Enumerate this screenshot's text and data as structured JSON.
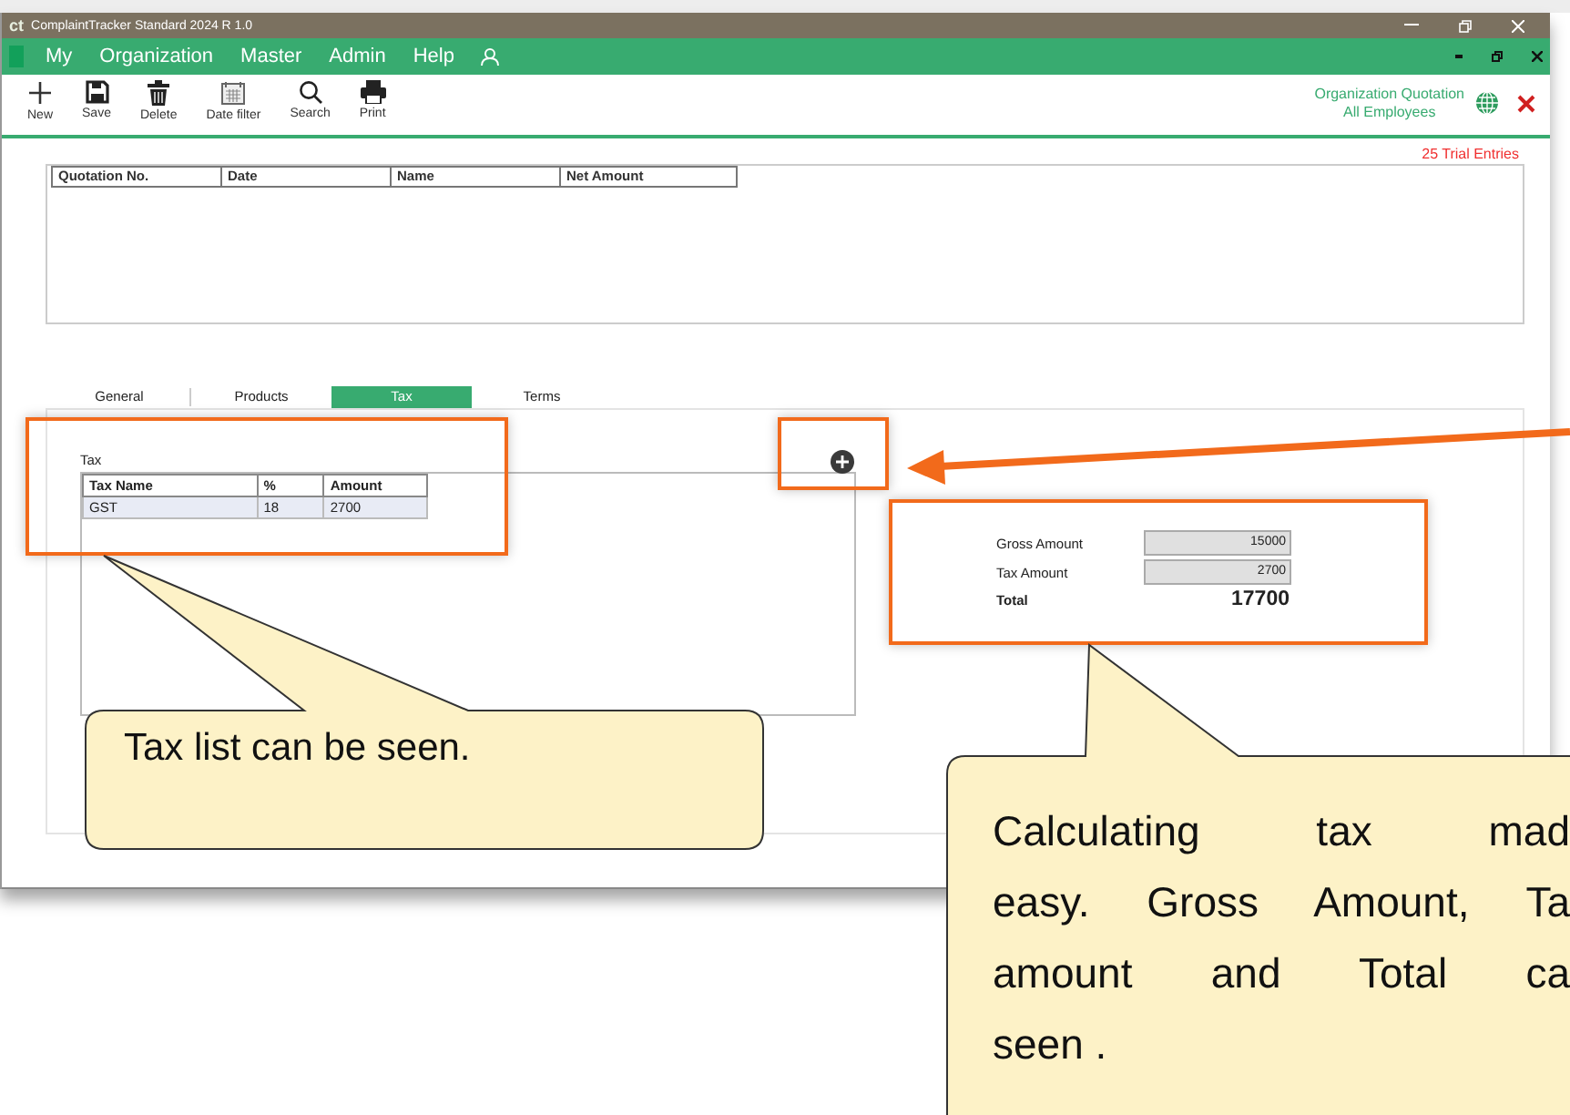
{
  "window": {
    "logo": "ct",
    "title": "ComplaintTracker Standard 2024 R 1.0"
  },
  "menu": [
    "My",
    "Organization",
    "Master",
    "Admin",
    "Help"
  ],
  "toolbar": [
    {
      "label": "New",
      "kind": "plus"
    },
    {
      "label": "Save",
      "kind": "save"
    },
    {
      "label": "Delete",
      "kind": "trash"
    },
    {
      "label": "Date filter",
      "kind": "calendar"
    },
    {
      "label": "Search",
      "kind": "search"
    },
    {
      "label": "Print",
      "kind": "print"
    }
  ],
  "context": [
    "Organization Quotation",
    "All Employees"
  ],
  "trial_notice": "25 Trial Entries",
  "list": {
    "columns": [
      "Quotation No.",
      "Date",
      "Name",
      "Net Amount"
    ]
  },
  "tabs": [
    {
      "label": "General",
      "selected": false
    },
    {
      "label": "Products",
      "selected": false
    },
    {
      "label": "Tax",
      "selected": true
    },
    {
      "label": "Terms",
      "selected": false
    }
  ],
  "tax": {
    "title": "Tax",
    "columns": [
      "Tax Name",
      "%",
      "Amount"
    ],
    "rows": [
      [
        "GST",
        "18",
        "2700"
      ]
    ]
  },
  "summary": [
    {
      "label": "Gross Amount",
      "value": "15000",
      "kind": "field"
    },
    {
      "label": "Tax Amount",
      "value": "2700",
      "kind": "field"
    },
    {
      "label": "Total",
      "value": "17700",
      "kind": "total"
    }
  ],
  "callouts": [
    {
      "lines": [
        "Tax list can be seen."
      ]
    },
    {
      "lines": [
        "Calculating tax mad",
        "easy. Gross Amount, Ta",
        "amount and Total ca",
        "seen ."
      ]
    }
  ]
}
